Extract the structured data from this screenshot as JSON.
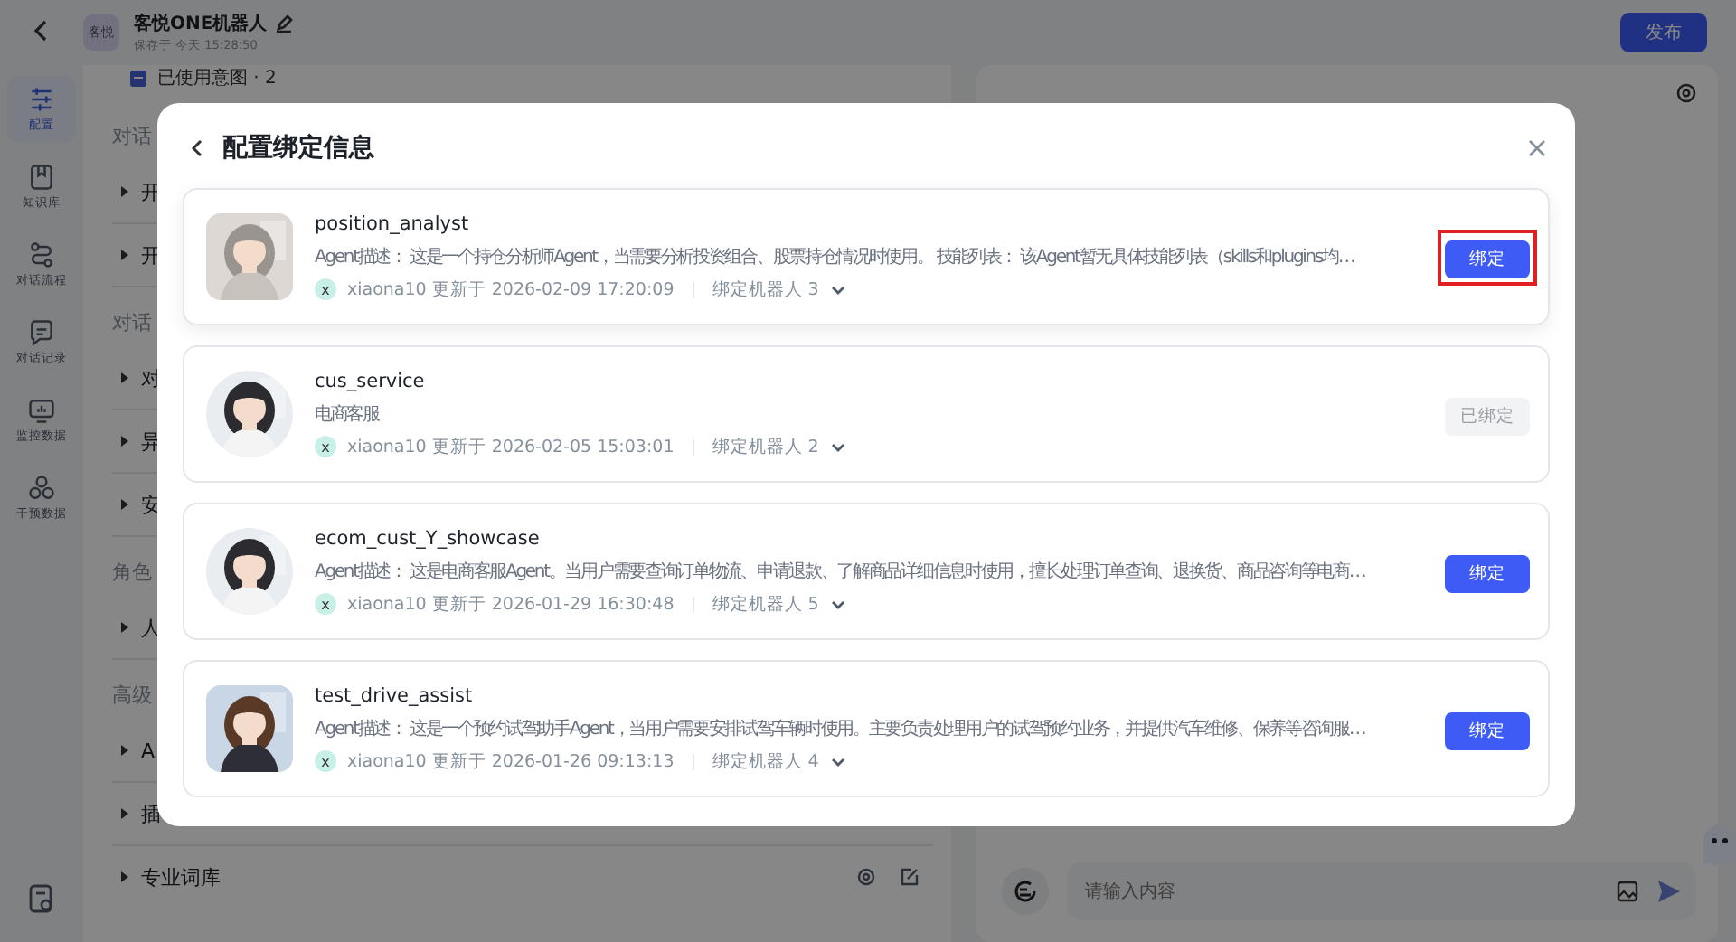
{
  "nav_rail": {
    "items": [
      {
        "label": "配置",
        "selected": true
      },
      {
        "label": "知识库",
        "selected": false
      },
      {
        "label": "对话流程",
        "selected": false
      },
      {
        "label": "对话记录",
        "selected": false
      },
      {
        "label": "监控数据",
        "selected": false
      },
      {
        "label": "干预数据",
        "selected": false
      }
    ]
  },
  "header": {
    "badge": "客悦",
    "title": "客悦ONE机器人",
    "saved": "保存于 今天 15:28:50",
    "publish_button": "发布"
  },
  "config_panel": {
    "intent_summary": "已使用意图 · 2",
    "items": [
      {
        "kind": "section",
        "label": "对话"
      },
      {
        "kind": "row",
        "label": "开"
      },
      {
        "kind": "row",
        "label": "开"
      },
      {
        "kind": "section",
        "label": "对话"
      },
      {
        "kind": "row",
        "label": "对"
      },
      {
        "kind": "row",
        "label": "异"
      },
      {
        "kind": "row",
        "label": "安"
      },
      {
        "kind": "section",
        "label": "角色"
      },
      {
        "kind": "row",
        "label": "人"
      },
      {
        "kind": "section",
        "label": "高级"
      },
      {
        "kind": "row",
        "label": "A"
      },
      {
        "kind": "row",
        "label": "插"
      },
      {
        "kind": "row",
        "label": "专业词库",
        "actions": true
      }
    ]
  },
  "test_panel": {
    "input": {
      "placeholder": "请输入内容"
    }
  },
  "dialog": {
    "title": "配置绑定信息",
    "agents": [
      {
        "name": "position_analyst",
        "description": "Agent描述： 这是一个持仓分析师Agent，当需要分析投资组合、股票持仓情况时使用。 技能列表： 该Agent暂无具体技能列表（skills和plugins均…",
        "user_initial": "x",
        "updated": "xiaona10 更新于 2026-02-09 17:20:09",
        "bound_robots": "绑定机器人 3",
        "button": "绑定",
        "bound": false,
        "highlighted": true
      },
      {
        "name": "cus_service",
        "description": "电商客服",
        "user_initial": "x",
        "updated": "xiaona10 更新于 2026-02-05 15:03:01",
        "bound_robots": "绑定机器人 2",
        "button": "已绑定",
        "bound": true,
        "highlighted": false
      },
      {
        "name": "ecom_cust_Y_showcase",
        "description": "Agent描述： 这是电商客服Agent。当用户需要查询订单物流、申请退款、了解商品详细信息时使用，擅长处理订单查询、退换货、商品咨询等电商…",
        "user_initial": "x",
        "updated": "xiaona10 更新于 2026-01-29 16:30:48",
        "bound_robots": "绑定机器人 5",
        "button": "绑定",
        "bound": false,
        "highlighted": false
      },
      {
        "name": "test_drive_assist",
        "description": "Agent描述： 这是一个预约试驾助手Agent，当用户需要安排试驾车辆时使用。主要负责处理用户的试驾预约业务，并提供汽车维修、保养等咨询服…",
        "user_initial": "x",
        "updated": "xiaona10 更新于 2026-01-26 09:13:13",
        "bound_robots": "绑定机器人 4",
        "button": "绑定",
        "bound": false,
        "highlighted": false
      }
    ]
  }
}
